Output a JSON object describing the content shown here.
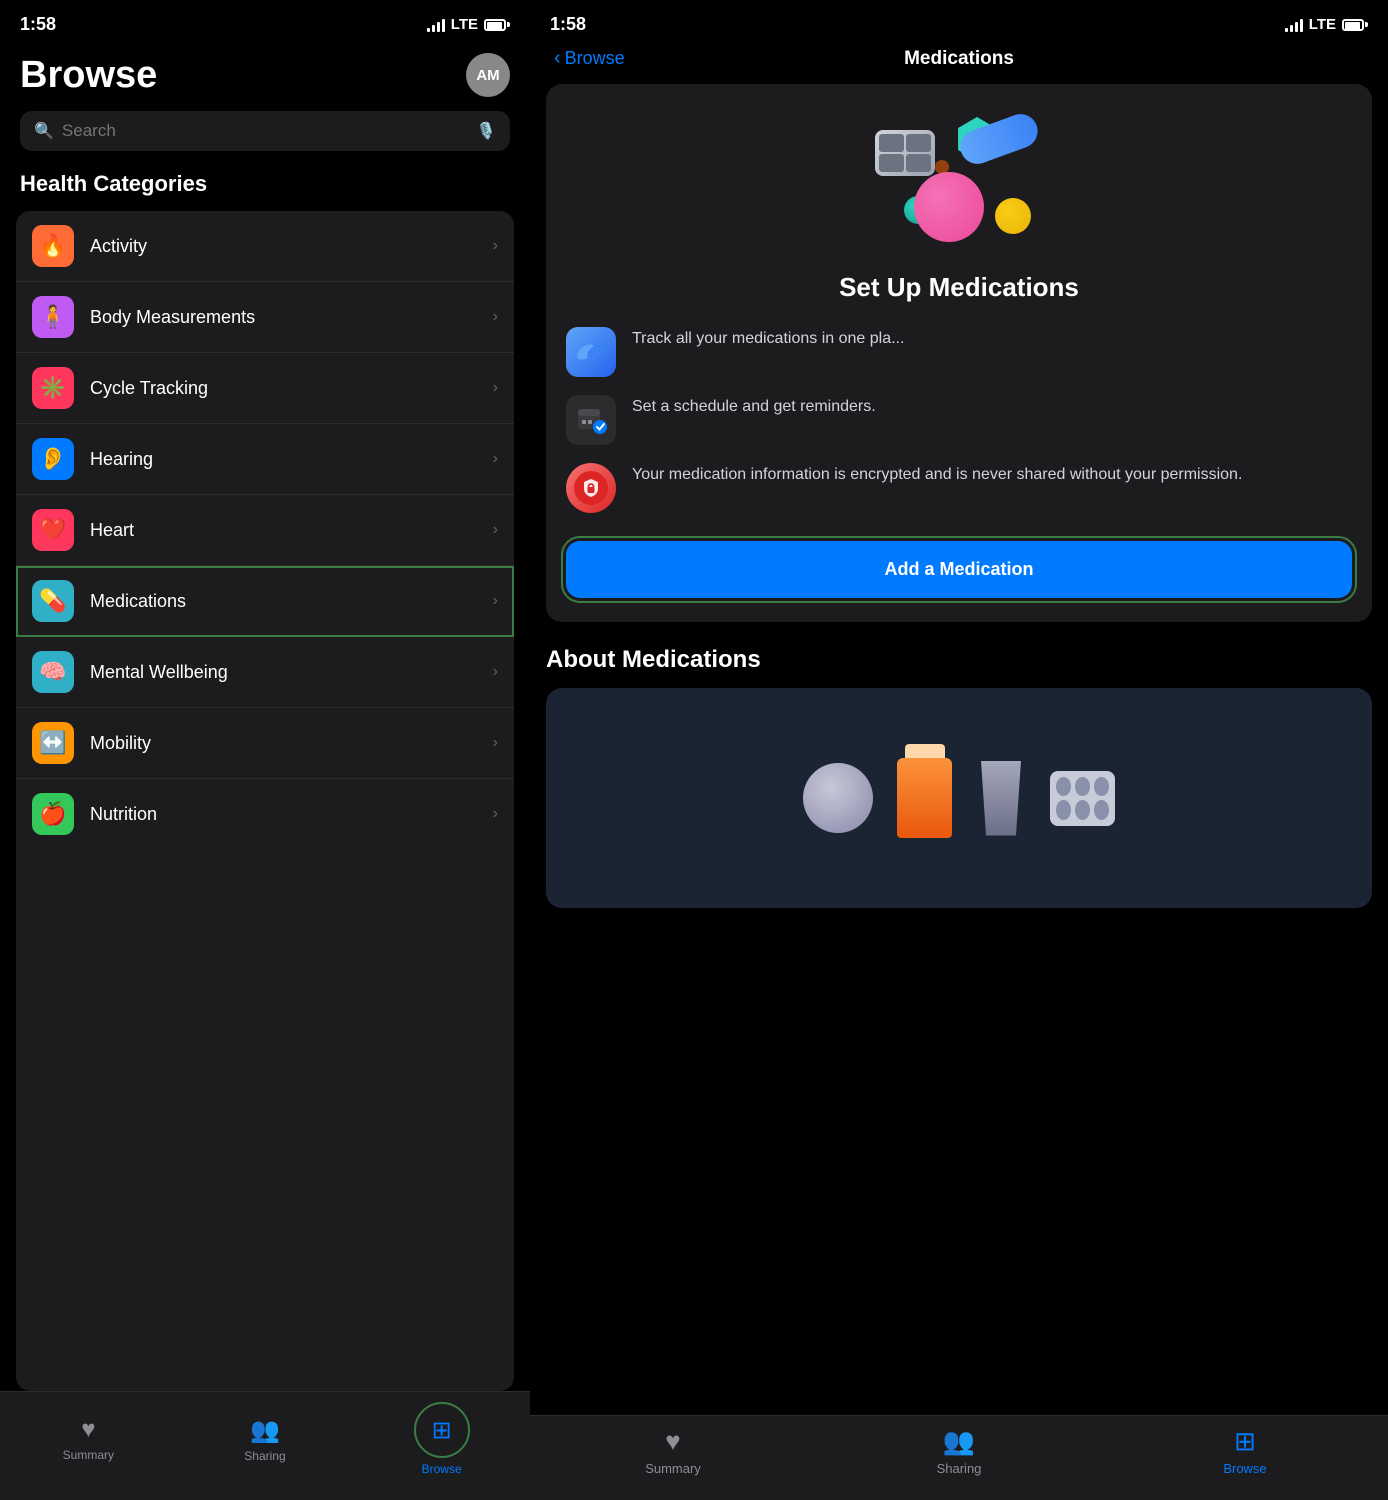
{
  "left": {
    "status": {
      "time": "1:58",
      "indicator": "A",
      "network": "LTE"
    },
    "header": {
      "title": "Browse",
      "avatar": "AM"
    },
    "search": {
      "placeholder": "Search"
    },
    "categories_title": "Health Categories",
    "categories": [
      {
        "id": "activity",
        "label": "Activity",
        "icon": "🔥",
        "iconBg": "#ff6b35",
        "selected": false
      },
      {
        "id": "body-measurements",
        "label": "Body Measurements",
        "icon": "🧍",
        "iconBg": "#bf5af2",
        "selected": false
      },
      {
        "id": "cycle-tracking",
        "label": "Cycle Tracking",
        "icon": "✳️",
        "iconBg": "#ff375f",
        "selected": false
      },
      {
        "id": "hearing",
        "label": "Hearing",
        "icon": "👂",
        "iconBg": "#007aff",
        "selected": false
      },
      {
        "id": "heart",
        "label": "Heart",
        "icon": "❤️",
        "iconBg": "#ff375f",
        "selected": false
      },
      {
        "id": "medications",
        "label": "Medications",
        "icon": "💊",
        "iconBg": "#30b0c7",
        "selected": true
      },
      {
        "id": "mental-wellbeing",
        "label": "Mental Wellbeing",
        "icon": "🧠",
        "iconBg": "#30b0c7",
        "selected": false
      },
      {
        "id": "mobility",
        "label": "Mobility",
        "icon": "↔️",
        "iconBg": "#ff9500",
        "selected": false
      },
      {
        "id": "nutrition",
        "label": "Nutrition",
        "icon": "🍎",
        "iconBg": "#34c759",
        "selected": false
      }
    ],
    "tabs": [
      {
        "id": "summary",
        "label": "Summary",
        "icon": "♥",
        "active": false
      },
      {
        "id": "sharing",
        "label": "Sharing",
        "icon": "👥",
        "active": false
      },
      {
        "id": "browse",
        "label": "Browse",
        "icon": "⊞",
        "active": true
      }
    ]
  },
  "right": {
    "status": {
      "time": "1:58",
      "indicator": "A",
      "network": "LTE"
    },
    "nav": {
      "back_label": "Browse",
      "title": "Medications"
    },
    "card": {
      "title": "Set Up Medications",
      "features": [
        {
          "id": "track",
          "text": "Track all your medications in one pla..."
        },
        {
          "id": "schedule",
          "text": "Set a schedule and get reminders."
        },
        {
          "id": "privacy",
          "text": "Your medication information is encrypted and is never shared without your permission."
        }
      ],
      "add_button_label": "Add a Medication"
    },
    "about_section": {
      "title": "About Medications"
    },
    "tabs": [
      {
        "id": "summary",
        "label": "Summary",
        "icon": "♥",
        "active": false
      },
      {
        "id": "sharing",
        "label": "Sharing",
        "icon": "👥",
        "active": false
      },
      {
        "id": "browse",
        "label": "Browse",
        "icon": "⊞",
        "active": true
      }
    ]
  }
}
